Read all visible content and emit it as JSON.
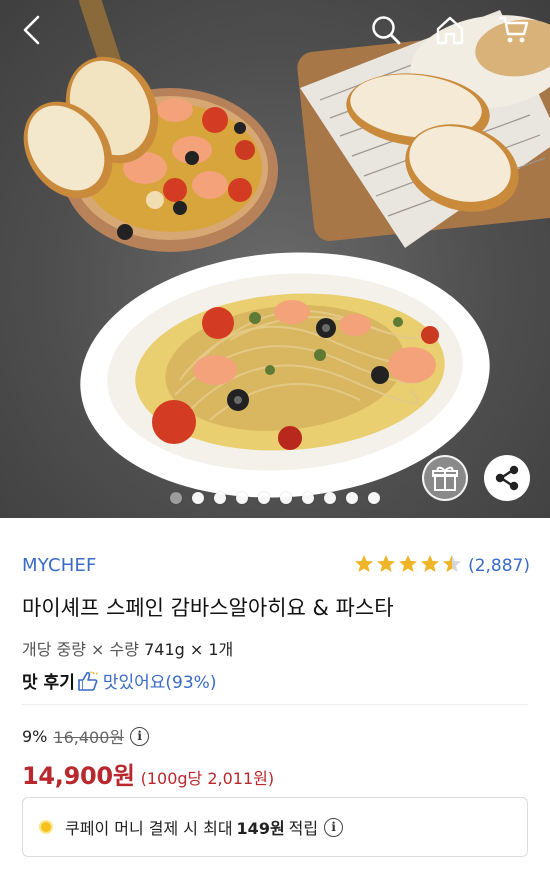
{
  "nav": {
    "back_icon": "chevron-left-icon",
    "search_icon": "search-icon",
    "home_icon": "home-icon",
    "cart_icon": "cart-icon"
  },
  "hero": {
    "image_count": 10,
    "active_index": 0,
    "gift_icon": "gift-icon",
    "share_icon": "share-icon"
  },
  "product": {
    "brand": "MYCHEF",
    "rating_value": 4.5,
    "rating_max": 5,
    "review_count": "(2,887)",
    "title": "마이셰프 스페인 감바스알아히요 & 파스타",
    "spec_label": "개당 중량 × 수량",
    "spec_value": "741g × 1개",
    "taste_label": "맛 후기",
    "taste_value": "맛있어요(93%)",
    "discount_rate": "9%",
    "original_price": "16,400원",
    "price": "14,900원",
    "unit_price": "(100g당 2,011원)"
  },
  "coupon": {
    "text_before": "쿠페이 머니 결제 시 최대",
    "amount": "149원",
    "text_after": "적립"
  },
  "colors": {
    "accent_blue": "#3a6bc8",
    "price_red": "#b8282d",
    "star": "#f0b429"
  }
}
